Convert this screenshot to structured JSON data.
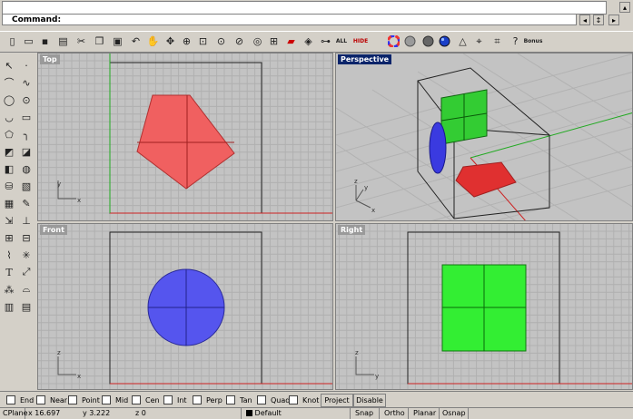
{
  "command": {
    "label": "Command:"
  },
  "toolbar": {
    "all_label": "ALL",
    "hide_label": "HIDE",
    "bonus_label": "Bonus"
  },
  "viewports": {
    "top": {
      "title": "Top"
    },
    "perspective": {
      "title": "Perspective"
    },
    "front": {
      "title": "Front"
    },
    "right": {
      "title": "Right"
    }
  },
  "axis_labels": {
    "x": "x",
    "y": "y",
    "z": "z"
  },
  "osnap": {
    "items": [
      "End",
      "Near",
      "Point",
      "Mid",
      "Cen",
      "Int",
      "Perp",
      "Tan",
      "Quad",
      "Knot"
    ],
    "project_label": "Project",
    "disable_label": "Disable"
  },
  "status": {
    "cplane": "CPlane",
    "x": "x 16.697",
    "y": "y 3.222",
    "z": "z 0",
    "layer": "Default",
    "snap": "Snap",
    "ortho": "Ortho",
    "planar": "Planar",
    "osnap": "Osnap"
  },
  "colors": {
    "viewport_bg": "#c3c3c3",
    "grid": "#b0b0b0",
    "active_title": "#0a246a",
    "pentagon": "#f06060",
    "circle": "#5555ee",
    "square": "#33ee33",
    "x_axis": "#cc2222",
    "y_axis": "#22aa22"
  },
  "icons": [
    "new-icon",
    "open-icon",
    "save-icon",
    "print-icon",
    "cut-icon",
    "copy-icon",
    "paste-icon",
    "undo-icon",
    "pan-icon",
    "rotate-view-icon",
    "zoom-icon",
    "zoom-window-icon",
    "zoom-extents-icon",
    "zoom-selected-icon",
    "four-view-icon",
    "car-icon",
    "layers-icon",
    "select-all-icon",
    "hide-icon",
    "color-wheel-icon",
    "shade-icon",
    "render-icon",
    "sphere-icon",
    "light-icon",
    "grid-icon",
    "snap-icon",
    "help-icon",
    "bonus-icon"
  ]
}
